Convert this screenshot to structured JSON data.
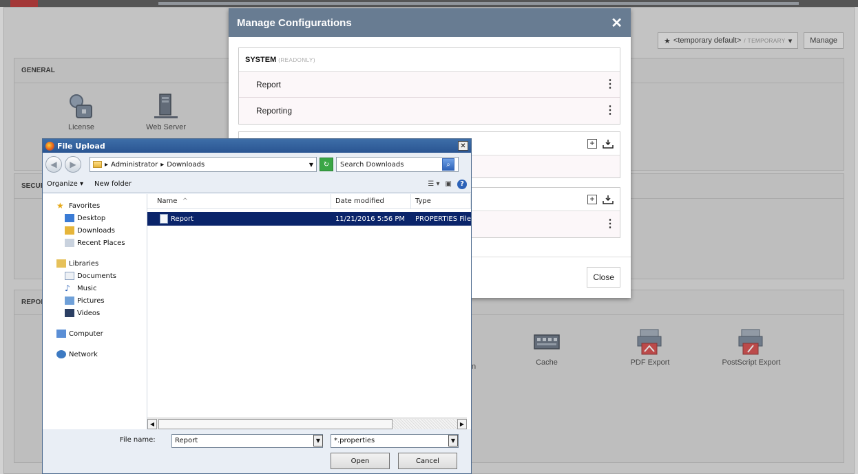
{
  "app": {
    "config_selector": {
      "name": "<temporary default>",
      "suffix": "/ TEMPORARY",
      "star": "★",
      "caret": "▾"
    },
    "manage_label": "Manage",
    "panels": {
      "general": {
        "title": "GENERAL",
        "tiles": [
          {
            "label": "License",
            "icon": "license-icon"
          },
          {
            "label": "Web Server",
            "icon": "server-icon"
          }
        ]
      },
      "security": {
        "title": "SECURITY"
      },
      "report": {
        "title": "REPORT",
        "tiles": [
          {
            "label": "Cache",
            "icon": "cache-icon"
          },
          {
            "label": "PDF Export",
            "icon": "pdf-export-icon"
          },
          {
            "label": "PostScript Export",
            "icon": "postscript-export-icon"
          }
        ],
        "partial_label": "n"
      }
    }
  },
  "modal": {
    "title": "Manage Configurations",
    "close_symbol": "✕",
    "sections": {
      "system": {
        "name": "SYSTEM",
        "badge": "(READONLY)",
        "rows": [
          "Report",
          "Reporting"
        ]
      }
    },
    "close_label": "Close",
    "icons": {
      "add": "+",
      "download": "download-icon",
      "menu": "⋮"
    }
  },
  "file_dialog": {
    "title": "File Upload",
    "close_symbol": "✕",
    "address": {
      "parts": [
        "Administrator",
        "Downloads"
      ],
      "sep": "▸"
    },
    "search_placeholder": "Search Downloads",
    "commands": {
      "organize": "Organize ▾",
      "new_folder": "New folder"
    },
    "nav": {
      "favorites": "Favorites",
      "favorites_items": [
        "Desktop",
        "Downloads",
        "Recent Places"
      ],
      "libraries": "Libraries",
      "libraries_items": [
        "Documents",
        "Music",
        "Pictures",
        "Videos"
      ],
      "computer": "Computer",
      "network": "Network"
    },
    "columns": {
      "name": "Name",
      "name_sort": "^",
      "date": "Date modified",
      "type": "Type"
    },
    "files": [
      {
        "name": "Report",
        "date": "11/21/2016 5:56 PM",
        "type": "PROPERTIES File"
      }
    ],
    "file_name_label": "File name:",
    "file_name_value": "Report",
    "file_type_value": "*.properties",
    "open_label": "Open",
    "cancel_label": "Cancel"
  }
}
